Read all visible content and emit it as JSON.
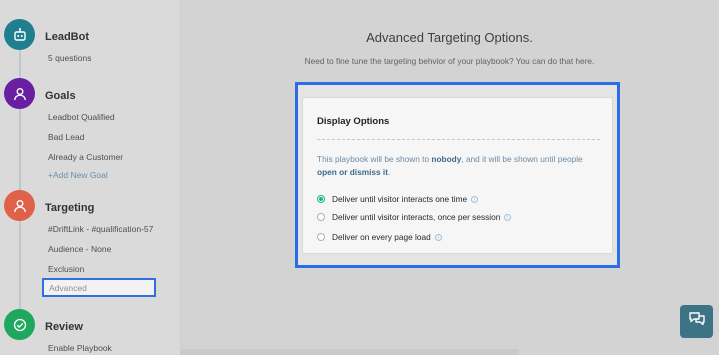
{
  "sidebar": {
    "leadbot": {
      "title": "LeadBot",
      "sub": "5 questions",
      "color": "#1f7f8f"
    },
    "goals": {
      "title": "Goals",
      "color": "#6a1fa3",
      "items": [
        "Leadbot Qualified",
        "Bad Lead",
        "Already a Customer"
      ],
      "add": "+Add New Goal"
    },
    "targeting": {
      "title": "Targeting",
      "color": "#e0614a",
      "items": [
        "#DriftLink - #qualification-57",
        "Audience - None",
        "Exclusion"
      ],
      "selected": "Advanced"
    },
    "review": {
      "title": "Review",
      "color": "#1fa85d",
      "items": [
        "Enable Playbook"
      ]
    }
  },
  "main": {
    "title": "Advanced Targeting Options.",
    "subtitle": "Need to fine tune the targeting behvior of your playbook? You can do that here."
  },
  "display_options": {
    "title": "Display Options",
    "desc_prefix": "This playbook will be shown to ",
    "desc_who": "nobody",
    "desc_mid": ", and it will be shown until people",
    "desc_until": "open or dismiss it",
    "desc_end": ".",
    "options": [
      {
        "label": "Deliver until visitor interacts one time",
        "checked": true
      },
      {
        "label": "Deliver until visitor interacts, once per session",
        "checked": false
      },
      {
        "label": "Deliver on every page load",
        "checked": false
      }
    ],
    "info_glyph": "i"
  },
  "accent": "#2a6de6"
}
